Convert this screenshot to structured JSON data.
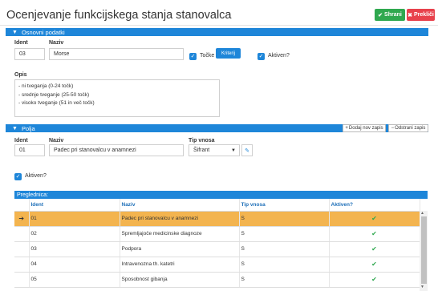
{
  "page": {
    "title": "Ocenjevanje funkcijskega stanja stanovalca"
  },
  "toolbar": {
    "save_label": "Shrani",
    "cancel_label": "Prekliči",
    "save_icon": "check-icon",
    "cancel_icon": "close-icon"
  },
  "osnovni": {
    "section_title": "Osnovni podatki",
    "ident_label": "Ident",
    "ident_value": "03",
    "naziv_label": "Naziv",
    "naziv_value": "Morse",
    "tocke_label": "Točke",
    "kriterij_label": "Kriterij",
    "aktiven_label": "Aktiven?",
    "opis_label": "Opis",
    "opis_lines": [
      "- ni tveganja (0-24  točk)",
      "- srednje tveganje (25-50 točk)",
      "- visoko tveganje (51 in več točk)"
    ]
  },
  "polja": {
    "section_title": "Polja",
    "add_label": "Dodaj nov zapis",
    "remove_label": "Odstrani zapis",
    "ident_label": "Ident",
    "ident_value": "01",
    "naziv_label": "Naziv",
    "naziv_value": "Padec pri stanovalcu v anamnezi",
    "tip_label": "Tip vnosa",
    "tip_value": "Šifrant",
    "aktiven_label": "Aktiven?"
  },
  "grid": {
    "caption": "Preglednica:",
    "columns": [
      "",
      "Ident",
      "Naziv",
      "Tip vnosa",
      "Aktiven?"
    ],
    "rows": [
      {
        "ident": "01",
        "naziv": "Padec pri stanovalcu v anamnezi",
        "tip": "S",
        "aktiven": true,
        "selected": true
      },
      {
        "ident": "02",
        "naziv": "Spremljajoče medicinske diagnoze",
        "tip": "S",
        "aktiven": true,
        "selected": false
      },
      {
        "ident": "03",
        "naziv": "Podpora",
        "tip": "S",
        "aktiven": true,
        "selected": false
      },
      {
        "ident": "04",
        "naziv": "Intravenozna th. katetri",
        "tip": "S",
        "aktiven": true,
        "selected": false
      },
      {
        "ident": "05",
        "naziv": "Sposobnost gibanja",
        "tip": "S",
        "aktiven": true,
        "selected": false
      }
    ]
  }
}
